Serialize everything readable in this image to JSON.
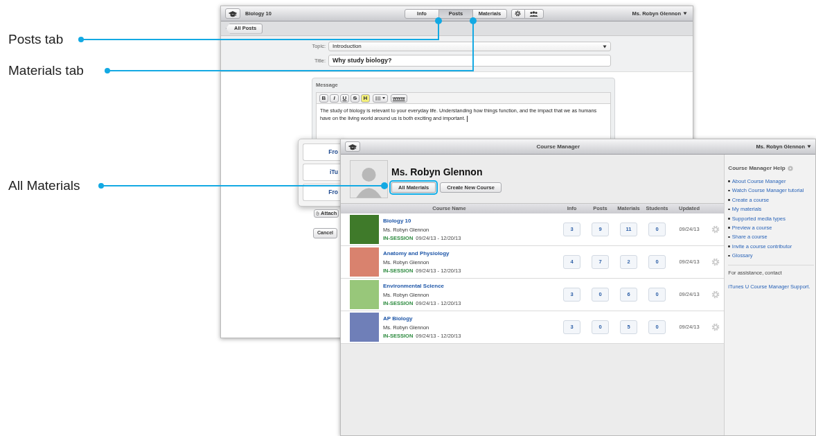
{
  "callouts": [
    {
      "label": "Posts tab"
    },
    {
      "label": "Materials tab"
    },
    {
      "label": "All Materials"
    }
  ],
  "post_editor": {
    "course_title": "Biology 10",
    "tabs": [
      {
        "label": "Info",
        "selected": false
      },
      {
        "label": "Posts",
        "selected": true
      },
      {
        "label": "Materials",
        "selected": false
      }
    ],
    "user": "Ms. Robyn Glennon",
    "back_button": "All Posts",
    "topic": {
      "label": "Topic:",
      "value": "Introduction"
    },
    "title": {
      "label": "Title:",
      "value": "Why study biology?"
    },
    "message": {
      "label": "Message",
      "toolbar": [
        {
          "label": "B",
          "kind": "bold"
        },
        {
          "label": "I",
          "kind": "italic"
        },
        {
          "label": "U",
          "kind": "underline"
        },
        {
          "label": "S",
          "kind": "strike"
        },
        {
          "label": "H",
          "kind": "highlight"
        }
      ],
      "link_button": "www",
      "body": "The study of biology is relevant to your everyday life. Understanding how things function, and the impact that we as humans have on the living world around us is both exciting and important."
    },
    "attach_menu": [
      {
        "label": "Fro"
      },
      {
        "label": "iTu"
      },
      {
        "label": "Fro"
      }
    ],
    "attach_button": "Attach",
    "cancel_button": "Cancel"
  },
  "course_manager": {
    "title": "Course Manager",
    "user": "Ms. Robyn Glennon",
    "profile_name": "Ms. Robyn Glennon",
    "buttons": [
      {
        "label": "All Materials",
        "highlighted": true
      },
      {
        "label": "Create New Course",
        "highlighted": false
      }
    ],
    "table": {
      "columns": [
        "Course Name",
        "Info",
        "Posts",
        "Materials",
        "Students",
        "Updated"
      ],
      "rows": [
        {
          "name": "Biology 10",
          "teacher": "Ms. Robyn Glennon",
          "status": "IN-SESSION",
          "dates": "09/24/13 - 12/20/13",
          "info": "3",
          "posts": "9",
          "materials": "11",
          "students": "0",
          "updated": "09/24/13"
        },
        {
          "name": "Anatomy and Physiology",
          "teacher": "Ms. Robyn Glennon",
          "status": "IN-SESSION",
          "dates": "09/24/13 - 12/20/13",
          "info": "4",
          "posts": "7",
          "materials": "2",
          "students": "0",
          "updated": "09/24/13"
        },
        {
          "name": "Environmental Science",
          "teacher": "Ms. Robyn Glennon",
          "status": "IN-SESSION",
          "dates": "09/24/13 - 12/20/13",
          "info": "3",
          "posts": "0",
          "materials": "6",
          "students": "0",
          "updated": "09/24/13"
        },
        {
          "name": "AP Biology",
          "teacher": "Ms. Robyn Glennon",
          "status": "IN-SESSION",
          "dates": "09/24/13 - 12/20/13",
          "info": "3",
          "posts": "0",
          "materials": "5",
          "students": "0",
          "updated": "09/24/13"
        }
      ]
    },
    "help": {
      "title": "Course Manager Help",
      "links": [
        "About Course Manager",
        "Watch Course Manager tutorial",
        "Create a course",
        "My materials",
        "Supported media types",
        "Preview a course",
        "Share a course",
        "Invite a course contributor",
        "Glossary"
      ],
      "assistance": "For assistance, contact",
      "support_link": "iTunes U Course Manager Support."
    }
  }
}
